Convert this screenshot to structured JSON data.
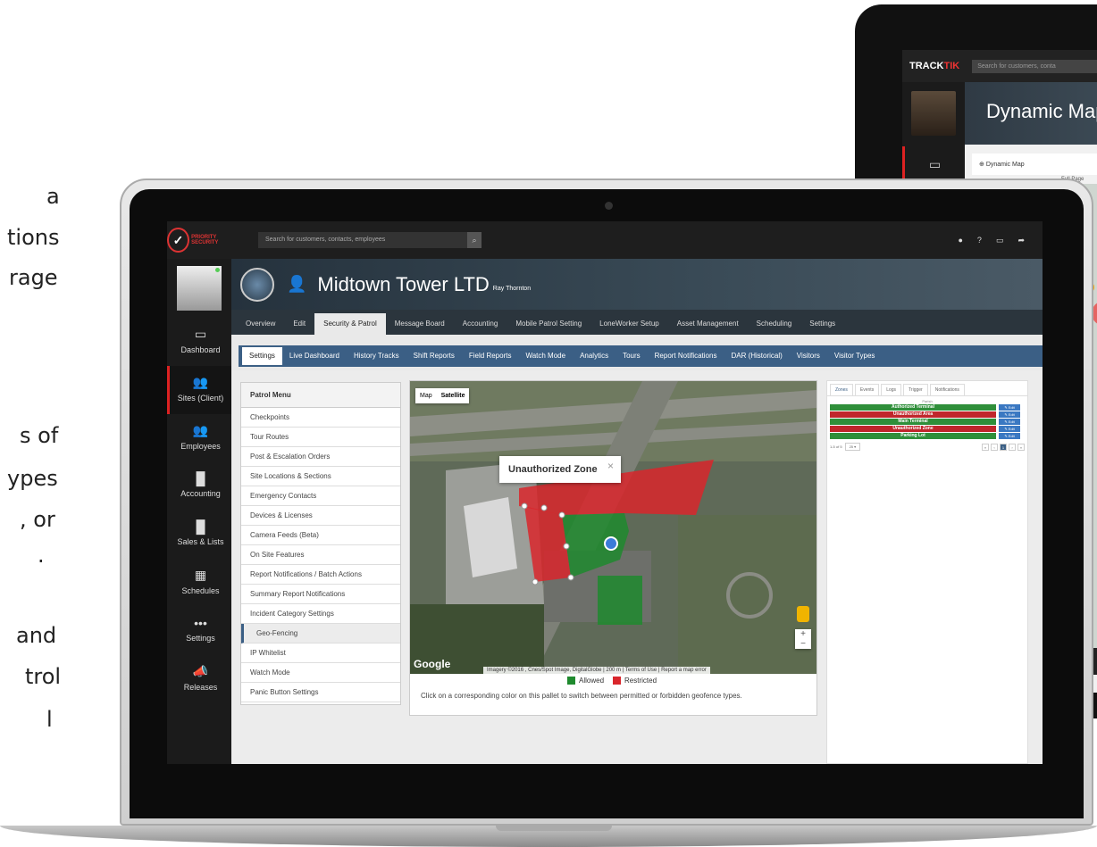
{
  "left_text_fragments": [
    {
      "text": "a"
    },
    {
      "text": "tions"
    },
    {
      "text": "rage"
    },
    {
      "text": "s of"
    },
    {
      "text": "ypes"
    },
    {
      "text": ", or"
    },
    {
      "text": "."
    },
    {
      "text": "and"
    },
    {
      "text": "trol"
    },
    {
      "text": "l"
    }
  ],
  "back_monitor": {
    "logo_a": "TRACK",
    "logo_b": "TIK",
    "search_placeholder": "Search for customers, conta",
    "page_title": "Dynamic Map",
    "breadcrumb": "Dynamic Map",
    "full_page": "Full Page"
  },
  "app": {
    "logo_text": "PRIORITY SECURITY",
    "search_placeholder": "Search for customers, contacts, employees",
    "top_icons": [
      "info-icon",
      "help-icon",
      "monitor-icon",
      "share-icon"
    ],
    "sidebar": [
      {
        "label": "Dashboard",
        "icon": "monitor-icon"
      },
      {
        "label": "Sites (Client)",
        "icon": "people-icon",
        "active": true
      },
      {
        "label": "Employees",
        "icon": "people-icon"
      },
      {
        "label": "Accounting",
        "icon": "bar-chart-icon"
      },
      {
        "label": "Sales & Lists",
        "icon": "bar-chart-icon"
      },
      {
        "label": "Schedules",
        "icon": "grid-icon"
      },
      {
        "label": "Settings",
        "icon": "dots-icon"
      },
      {
        "label": "Releases",
        "icon": "megaphone-icon"
      }
    ],
    "header": {
      "title": "Midtown Tower LTD",
      "subtitle": "Ray Thornton"
    },
    "tabs": [
      "Overview",
      "Edit",
      "Security & Patrol",
      "Message Board",
      "Accounting",
      "Mobile Patrol Setting",
      "LoneWorker Setup",
      "Asset Management",
      "Scheduling",
      "Settings"
    ],
    "active_tab": "Security & Patrol",
    "subtabs": [
      "Settings",
      "Live Dashboard",
      "History Tracks",
      "Shift Reports",
      "Field Reports",
      "Watch Mode",
      "Analytics",
      "Tours",
      "Report Notifications",
      "DAR (Historical)",
      "Visitors",
      "Visitor Types"
    ],
    "active_subtab": "Settings",
    "patrol_menu": {
      "title": "Patrol Menu",
      "items": [
        "Checkpoints",
        "Tour Routes",
        "Post & Escalation Orders",
        "Site Locations & Sections",
        "Emergency Contacts",
        "Devices & Licenses",
        "Camera Feeds (Beta)",
        "On Site Features",
        "Report Notifications / Batch Actions",
        "Summary Report Notifications",
        "Incident Category Settings",
        "Geo-Fencing",
        "IP Whitelist",
        "Watch Mode",
        "Panic Button Settings"
      ],
      "active": "Geo-Fencing"
    },
    "map": {
      "type_map": "Map",
      "type_satellite": "Satellite",
      "tooltip": "Unauthorized Zone",
      "google": "Google",
      "attribution": "Imagery ©2016 , Cnes/Spot Image, DigitalGlobe | 200 m",
      "terms": "Terms of Use | Report a map error",
      "legend_allowed": "Allowed",
      "legend_restricted": "Restricted",
      "allowed_color": "#1f8a2e",
      "restricted_color": "#d9262c",
      "note": "Click on a corresponding color on this pallet to switch between permitted or forbidden geofence types."
    },
    "zones_panel": {
      "tabs": [
        "Zones",
        "Events",
        "Logs",
        "Trigger",
        "Notifications"
      ],
      "column": "Parish",
      "rows": [
        {
          "name": "Authorized Terminal",
          "color": "#2f8f3a",
          "edit": "Edit"
        },
        {
          "name": "Unauthorized Area",
          "color": "#c0262c",
          "edit": "Edit"
        },
        {
          "name": "Main Terminal",
          "color": "#2f8f3a",
          "edit": "Edit"
        },
        {
          "name": "Unauthorized Zone",
          "color": "#c0262c",
          "edit": "Edit"
        },
        {
          "name": "Parking Lot",
          "color": "#2f8f3a",
          "edit": "Edit"
        }
      ],
      "pager_info": "1-5 of 5",
      "page_size": "25"
    }
  }
}
